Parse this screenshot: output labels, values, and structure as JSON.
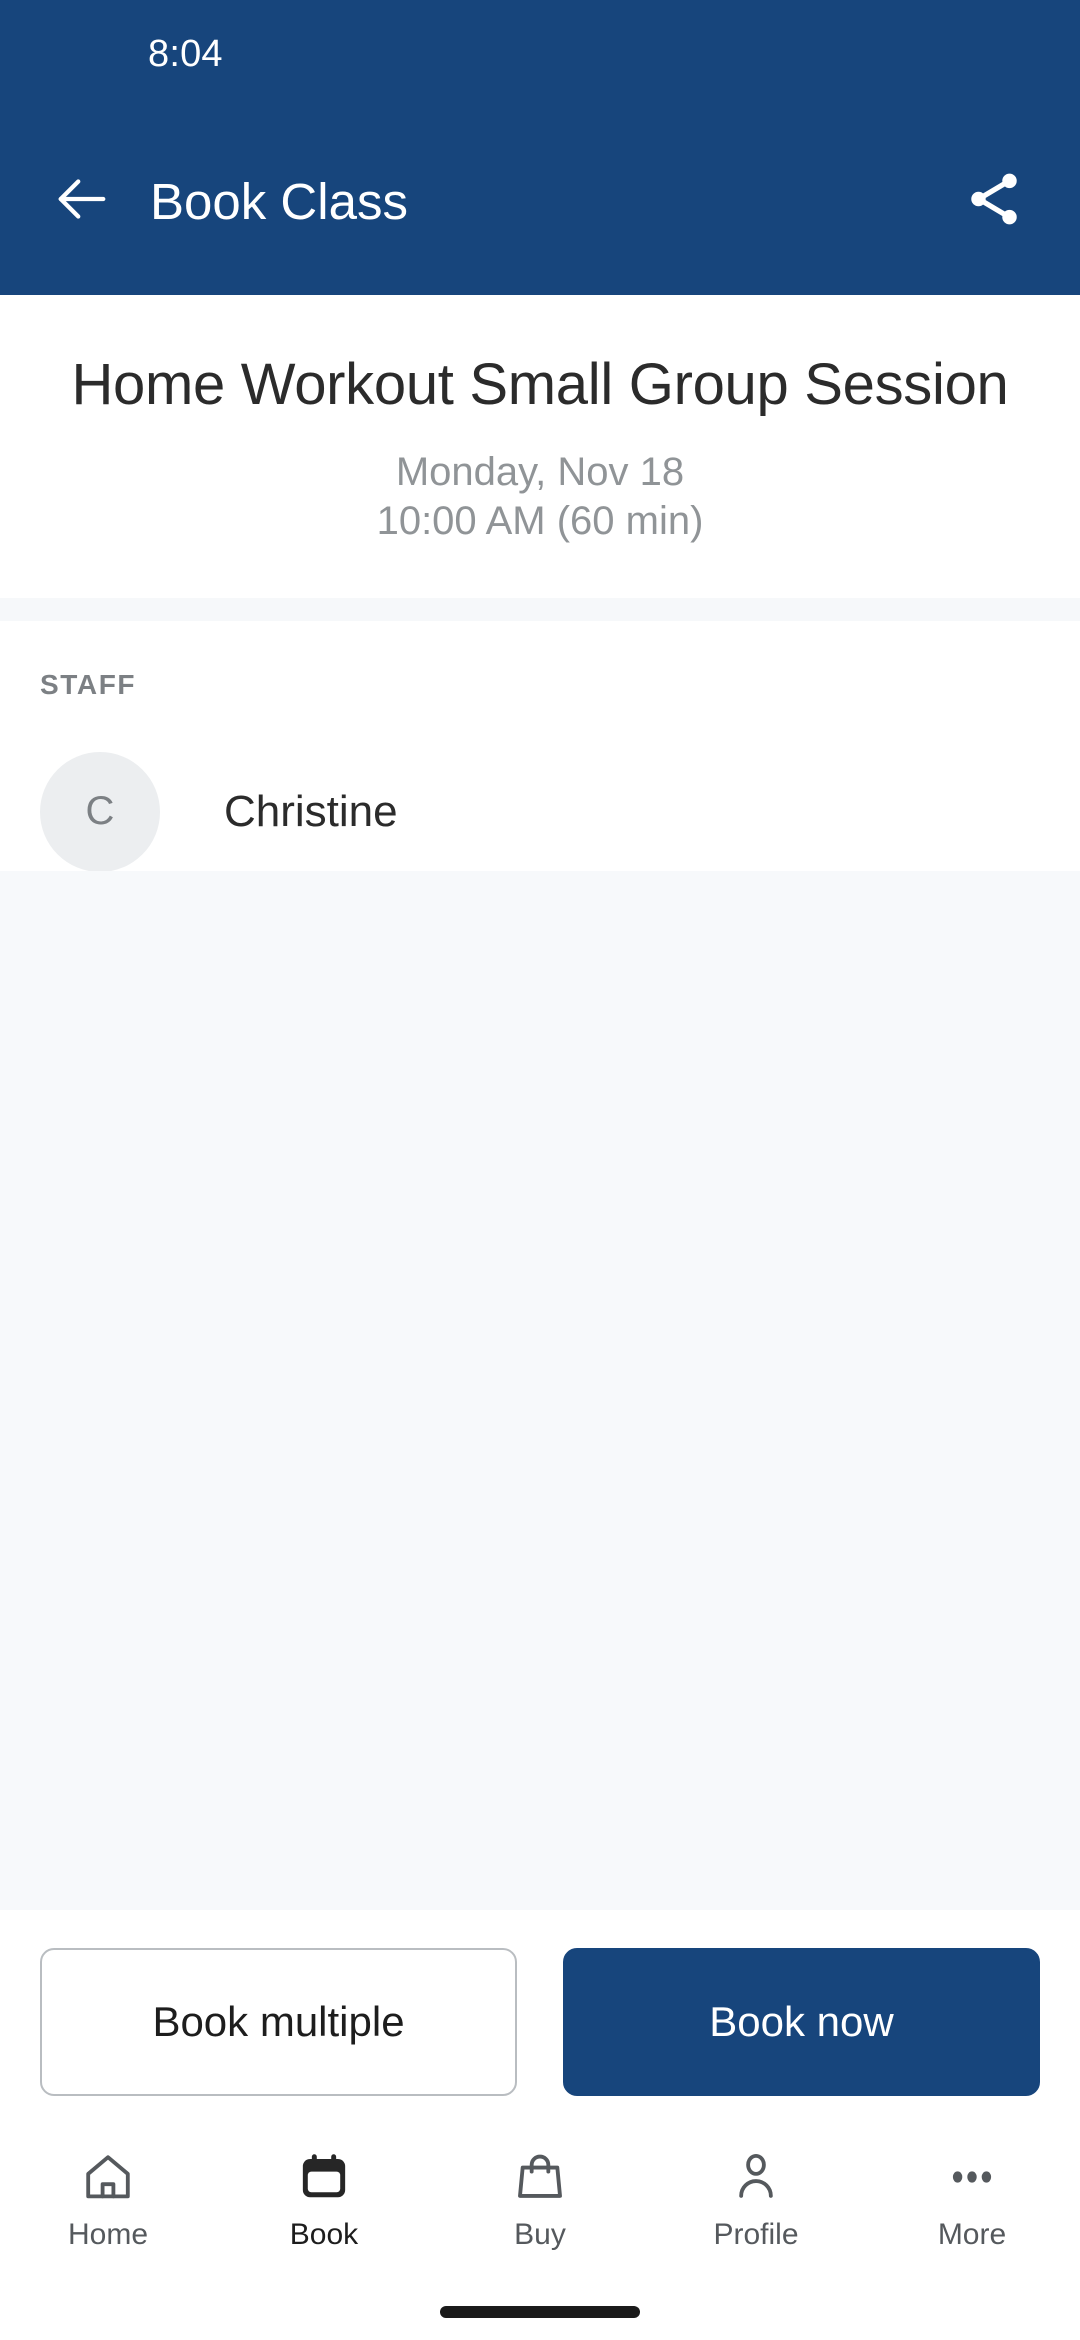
{
  "status_bar": {
    "time": "8:04"
  },
  "app_bar": {
    "title": "Book Class",
    "back_icon": "arrow-left-icon",
    "share_icon": "share-icon",
    "background_color": "#17457c"
  },
  "class_header": {
    "title": "Home Workout Small Group Session",
    "date": "Monday, Nov 18",
    "time": "10:00 AM (60 min)"
  },
  "staff_section": {
    "section_label": "STAFF",
    "members": [
      {
        "initial": "C",
        "name": "Christine"
      }
    ]
  },
  "actions": {
    "secondary_label": "Book multiple",
    "primary_label": "Book now",
    "primary_color": "#17457c"
  },
  "bottom_nav": {
    "active_index": 1,
    "items": [
      {
        "label": "Home",
        "icon": "home-icon"
      },
      {
        "label": "Book",
        "icon": "calendar-icon"
      },
      {
        "label": "Buy",
        "icon": "shopping-bag-icon"
      },
      {
        "label": "Profile",
        "icon": "person-icon"
      },
      {
        "label": "More",
        "icon": "ellipsis-icon"
      }
    ]
  }
}
